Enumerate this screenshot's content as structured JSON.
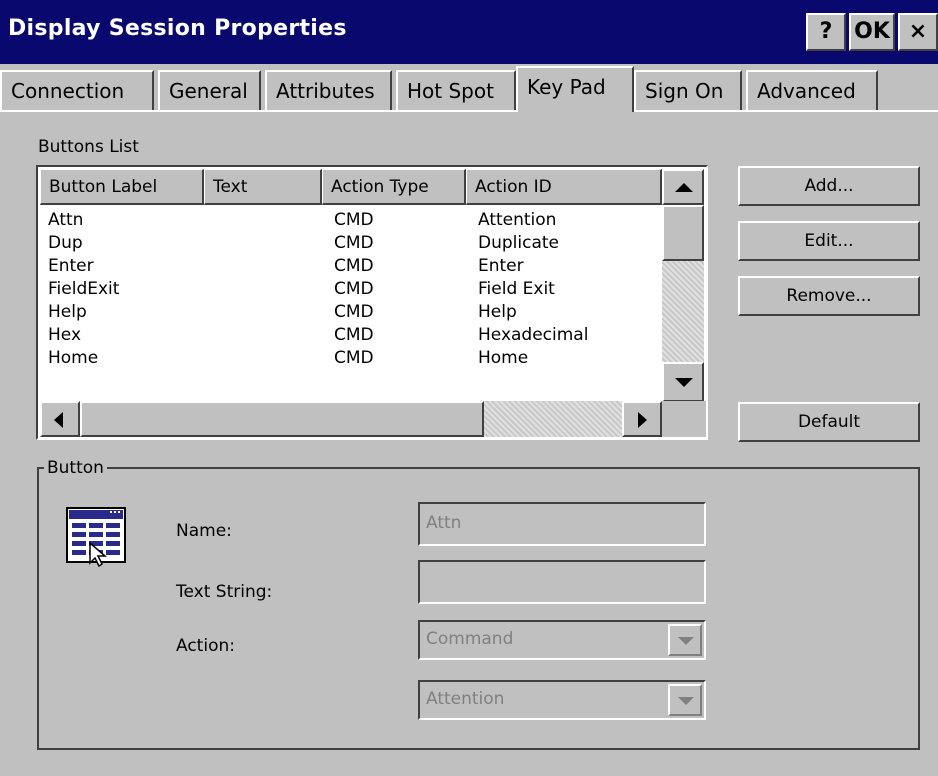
{
  "window": {
    "title": "Display Session Properties",
    "help_label": "?",
    "ok_label": "OK",
    "close_label": "×"
  },
  "tabs": [
    {
      "label": "Connection"
    },
    {
      "label": "General"
    },
    {
      "label": "Attributes"
    },
    {
      "label": "Hot Spot"
    },
    {
      "label": "Key Pad"
    },
    {
      "label": "Sign On"
    },
    {
      "label": "Advanced"
    }
  ],
  "active_tab": "Key Pad",
  "buttons_list": {
    "label": "Buttons List",
    "columns": [
      "Button Label",
      "Text",
      "Action Type",
      "Action ID"
    ],
    "rows": [
      {
        "label": "Attn",
        "text": "",
        "action_type": "CMD",
        "action_id": "Attention"
      },
      {
        "label": "Dup",
        "text": "",
        "action_type": "CMD",
        "action_id": "Duplicate"
      },
      {
        "label": "Enter",
        "text": "",
        "action_type": "CMD",
        "action_id": "Enter"
      },
      {
        "label": "FieldExit",
        "text": "",
        "action_type": "CMD",
        "action_id": "Field Exit"
      },
      {
        "label": "Help",
        "text": "",
        "action_type": "CMD",
        "action_id": "Help"
      },
      {
        "label": "Hex",
        "text": "",
        "action_type": "CMD",
        "action_id": "Hexadecimal"
      },
      {
        "label": "Home",
        "text": "",
        "action_type": "CMD",
        "action_id": "Home"
      }
    ]
  },
  "side_buttons": {
    "add": "Add...",
    "edit": "Edit...",
    "remove": "Remove...",
    "default": "Default"
  },
  "button_group": {
    "title": "Button",
    "name_label": "Name:",
    "name_value": "Attn",
    "text_string_label": "Text String:",
    "text_string_value": "",
    "action_label": "Action:",
    "action_value": "Command",
    "action_id_value": "Attention"
  },
  "colors": {
    "titlebar": "#08086e",
    "face": "#c0c0c0",
    "disabled_text": "#808080"
  }
}
